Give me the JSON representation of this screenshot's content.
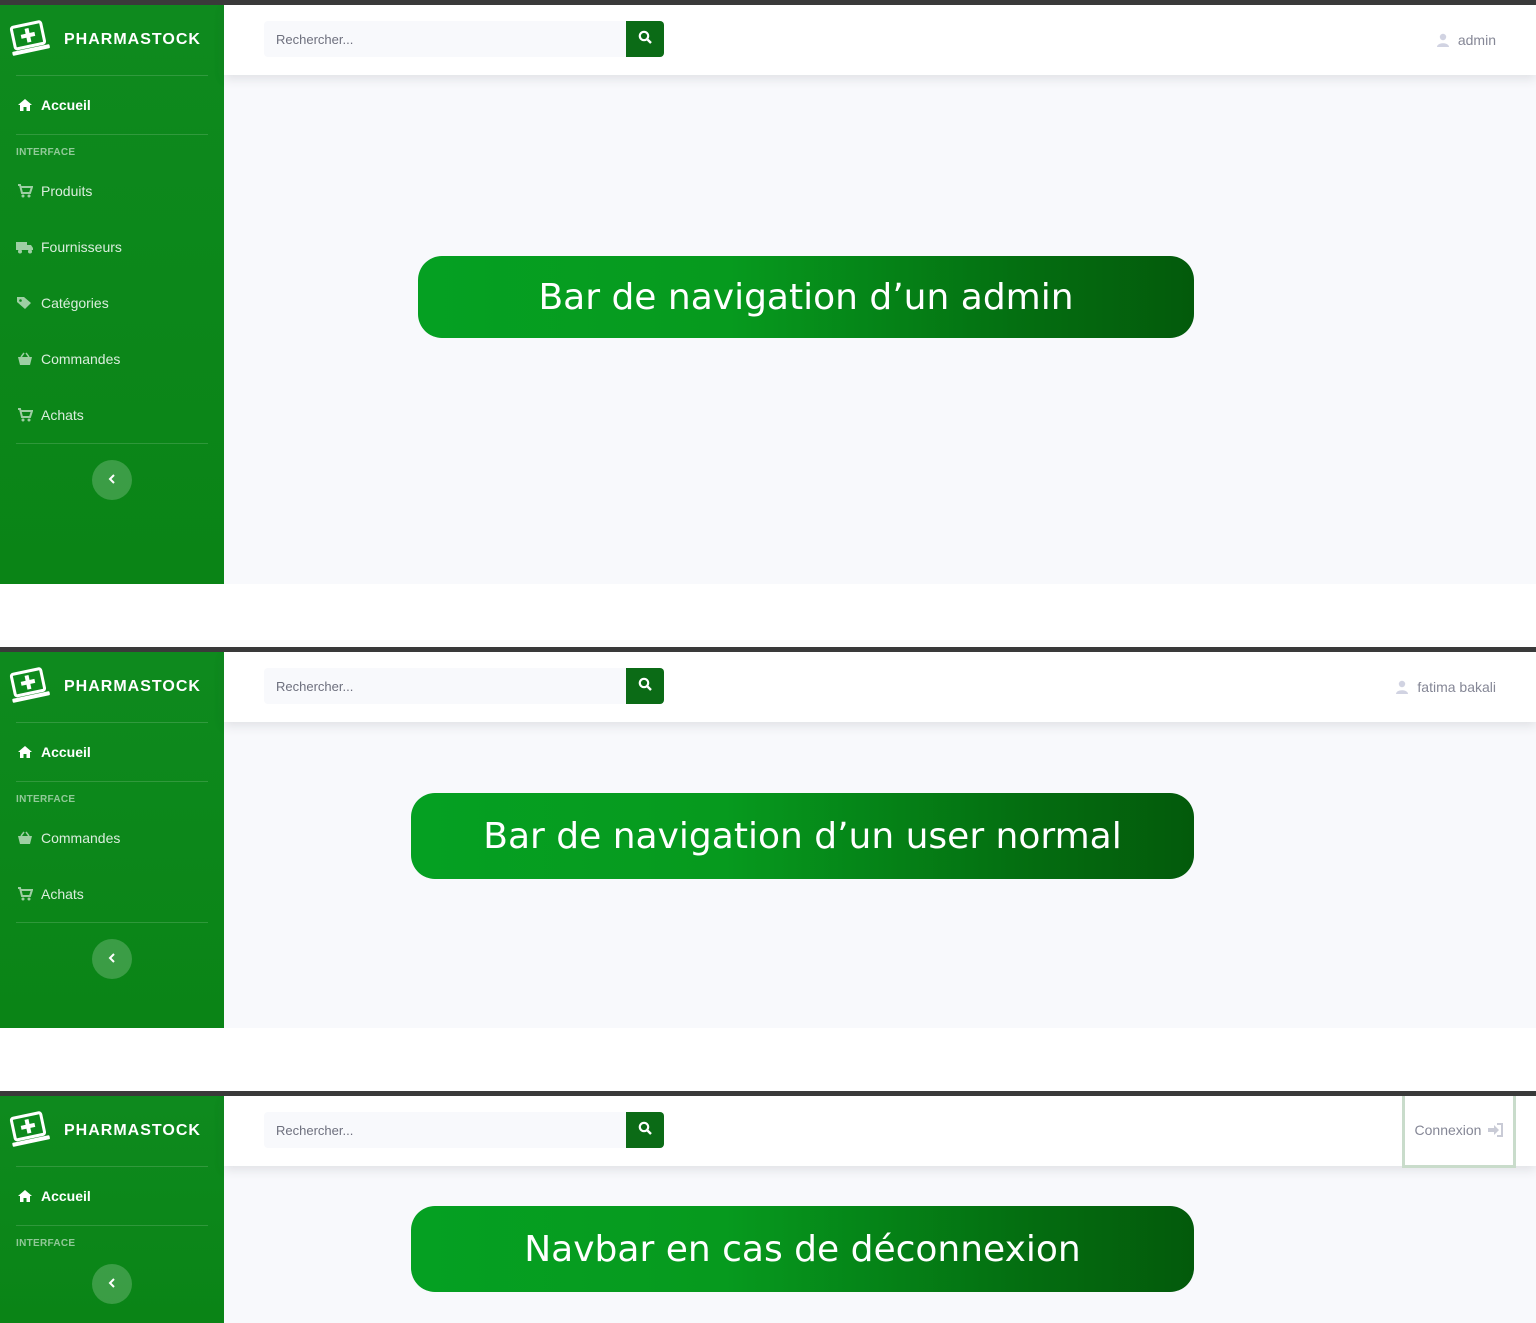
{
  "brand": "PHARMASTOCK",
  "search_placeholder": "Rechercher...",
  "home_label": "Accueil",
  "section_label": "INTERFACE",
  "panels": [
    {
      "nav": [
        "Produits",
        "Fournisseurs",
        "Catégories",
        "Commandes",
        "Achats"
      ],
      "user": "admin",
      "banner": "Bar de navigation d’un admin"
    },
    {
      "nav": [
        "Commandes",
        "Achats"
      ],
      "user": "fatima bakali",
      "banner": "Bar de navigation d’un user normal"
    },
    {
      "nav": [],
      "login": "Connexion",
      "banner": "Navbar en cas de déconnexion"
    }
  ],
  "colors": {
    "sidebar": "#0e8a1e",
    "search_button": "#0b6b16",
    "banner_start": "#05a022",
    "banner_end": "#035a0b"
  }
}
